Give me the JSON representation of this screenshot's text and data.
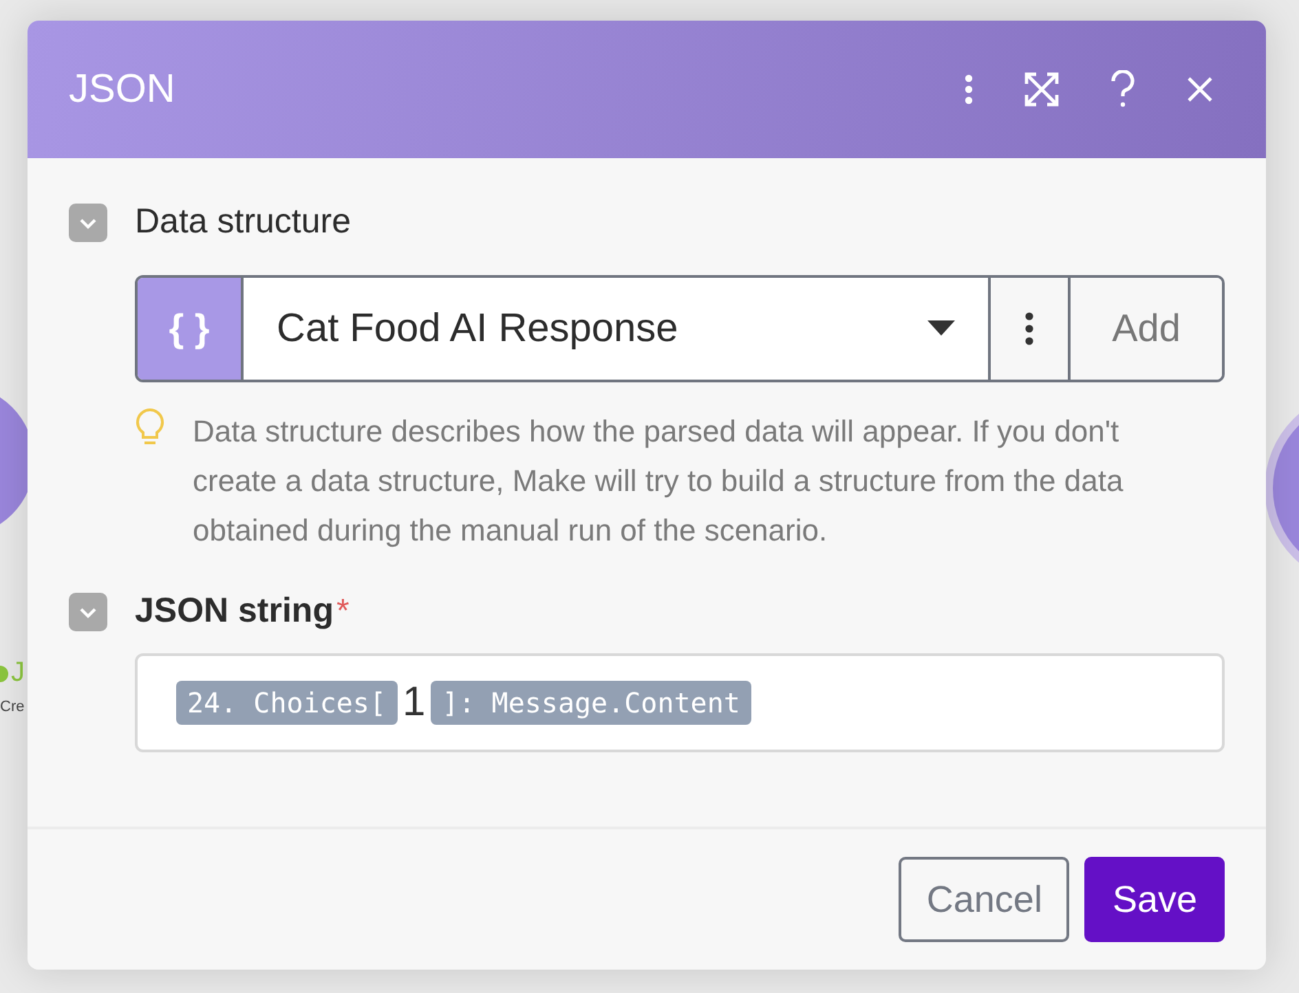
{
  "canvas": {
    "left_node": {
      "label": "J",
      "subtitle": "Cre"
    }
  },
  "window": {
    "title": "JSON"
  },
  "sections": [
    {
      "kind": "select",
      "title": "Data structure",
      "expanded": true,
      "required": false,
      "value": "Cat Food AI Response",
      "icon_text": "{ }",
      "add_label": "Add",
      "hint": "Data structure describes how the parsed data will appear. If you don't create a data structure, Make will try to build a structure from the data obtained during the manual run of the scenario."
    },
    {
      "kind": "tokens",
      "title": "JSON string",
      "expanded": true,
      "required": true,
      "required_mark": "*",
      "tokens": [
        {
          "kind": "pill",
          "text": "24. Choices["
        },
        {
          "kind": "text",
          "text": "1"
        },
        {
          "kind": "pill",
          "text": "]: Message.Content"
        }
      ]
    }
  ],
  "buttons": [
    {
      "label": "Cancel",
      "kind": "secondary"
    },
    {
      "label": "Save",
      "kind": "primary"
    }
  ]
}
